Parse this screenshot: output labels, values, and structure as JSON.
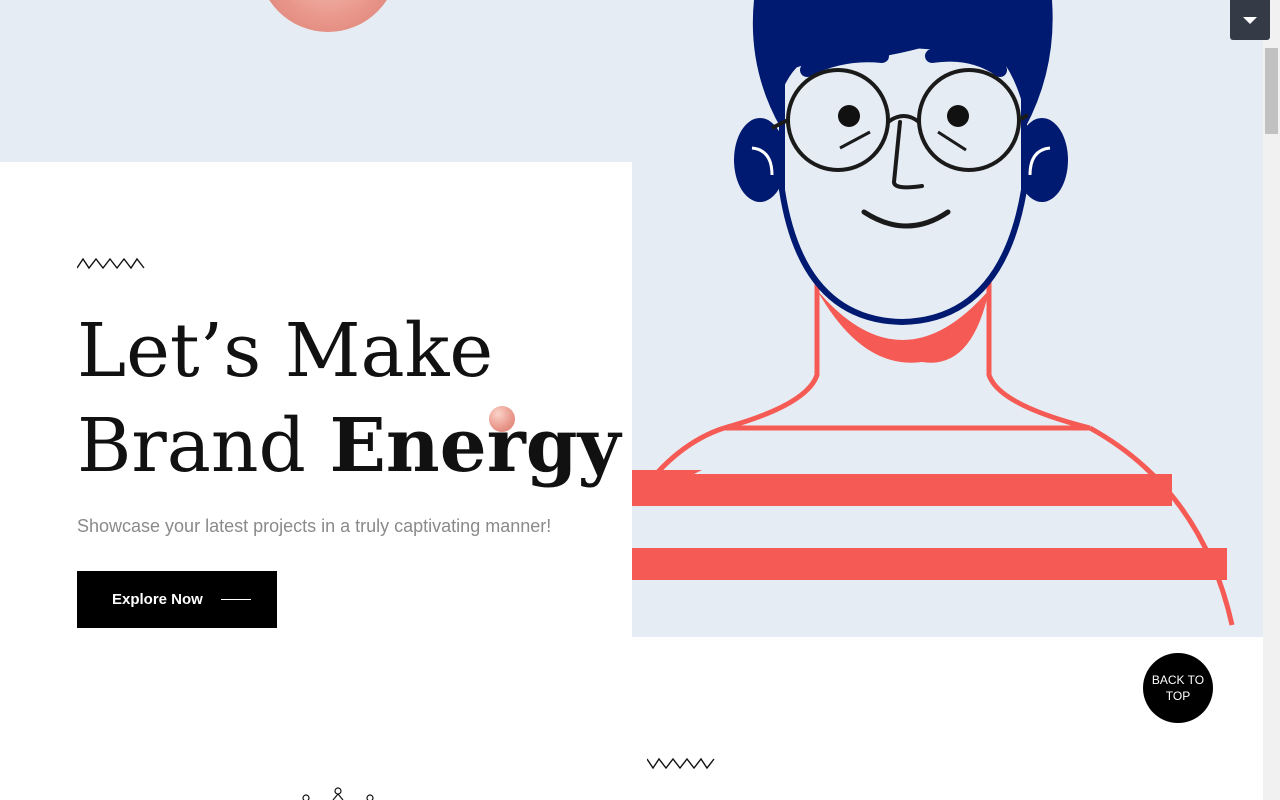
{
  "hero": {
    "headline_line1": "Let’s Make",
    "headline_line2_regular": "Brand ",
    "headline_line2_bold": "Energy",
    "subtitle": "Showcase your latest projects in a truly captivating manner!",
    "cta_label": "Explore Now"
  },
  "back_to_top": {
    "label": "BACK TO TOP"
  },
  "colors": {
    "hero_background": "#e6ecf3",
    "navy": "#001a72",
    "coral": "#f55a54",
    "black": "#000000"
  },
  "icons": {
    "dropdown": "chevron-down-icon",
    "cta_arrow": "line-arrow-icon"
  }
}
